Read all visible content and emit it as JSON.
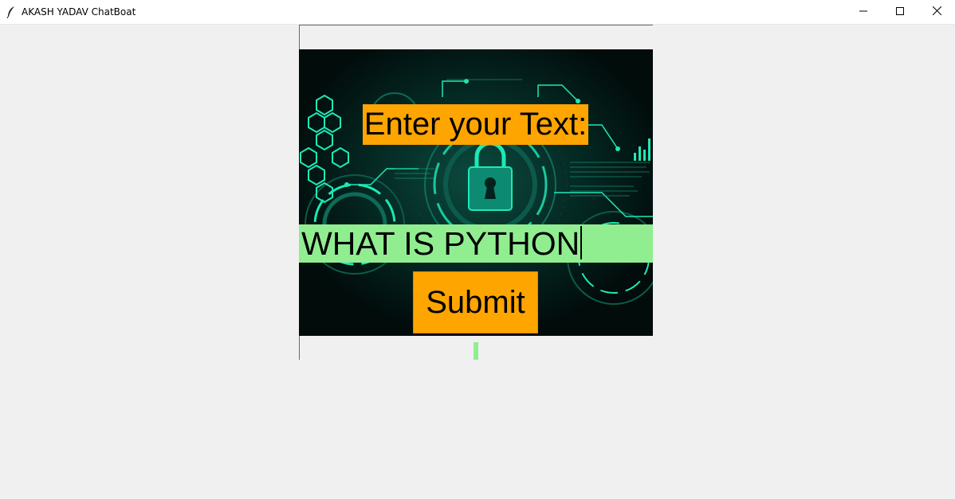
{
  "window": {
    "title": "AKASH YADAV ChatBoat",
    "icons": {
      "app": "feather-icon",
      "minimize": "minimize-icon",
      "maximize": "maximize-icon",
      "close": "close-icon"
    }
  },
  "form": {
    "prompt_label": "Enter your Text:",
    "input_value": "WHAT IS PYTHON",
    "submit_label": "Submit",
    "response_text": ""
  },
  "background": {
    "icon": "padlock-icon"
  },
  "colors": {
    "label_bg": "#ffa500",
    "entry_bg": "#90ee90",
    "image_bg": "#021614",
    "accent": "#1de9b6"
  }
}
